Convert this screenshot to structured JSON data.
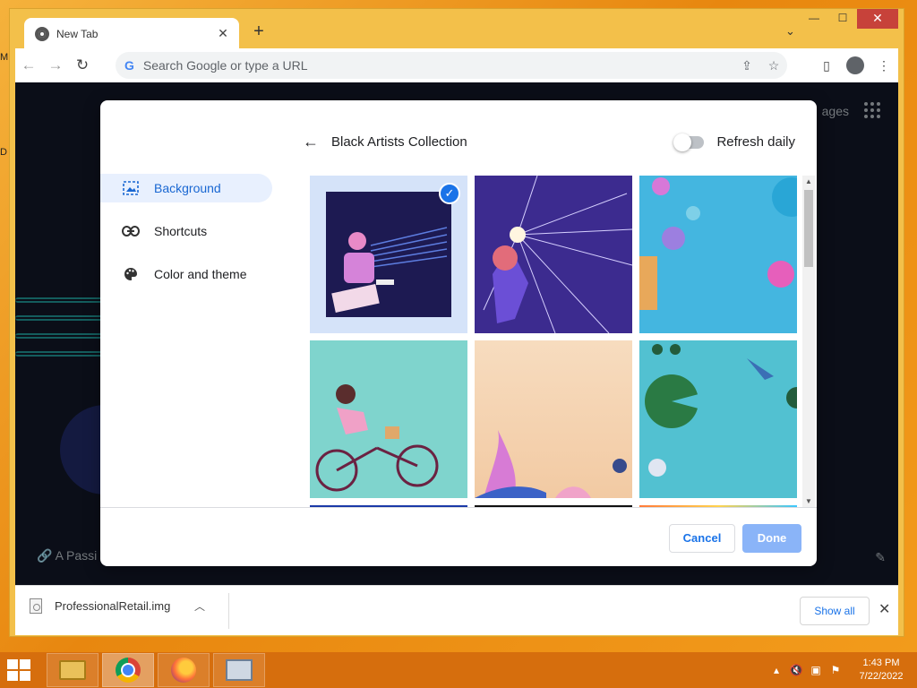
{
  "browser": {
    "tab_title": "New Tab",
    "tab_close": "✕",
    "new_tab": "+",
    "tab_search": "⌄",
    "window_controls": {
      "minimize": "—",
      "maximize": "☐",
      "close": "✕"
    },
    "omnibox_placeholder": "Search Google or type a URL",
    "g_logo": "G"
  },
  "page": {
    "images_label": "ages",
    "attribution": "A Passi"
  },
  "dialog": {
    "sidebar": [
      {
        "label": "Background",
        "icon": "image-icon",
        "selected": true
      },
      {
        "label": "Shortcuts",
        "icon": "link-icon",
        "selected": false
      },
      {
        "label": "Color and theme",
        "icon": "palette-icon",
        "selected": false
      }
    ],
    "collection_title": "Black Artists Collection",
    "refresh_label": "Refresh daily",
    "refresh_on": false,
    "selected_tile": 1,
    "cancel_label": "Cancel",
    "done_label": "Done"
  },
  "downloads": {
    "file_name": "ProfessionalRetail.img",
    "show_all": "Show all"
  },
  "taskbar": {
    "time": "1:43 PM",
    "date": "7/22/2022",
    "apps": [
      "file-explorer",
      "chrome",
      "firefox",
      "performance-monitor"
    ]
  },
  "desktop": {
    "edge_labels": [
      "M",
      "D"
    ]
  },
  "colors": {
    "accent": "#1a73e8",
    "selected_bg": "#e8f0fe",
    "done_disabled": "#8ab4f8",
    "taskbar": "#d66e0d",
    "window_frame": "#f3c04a"
  }
}
